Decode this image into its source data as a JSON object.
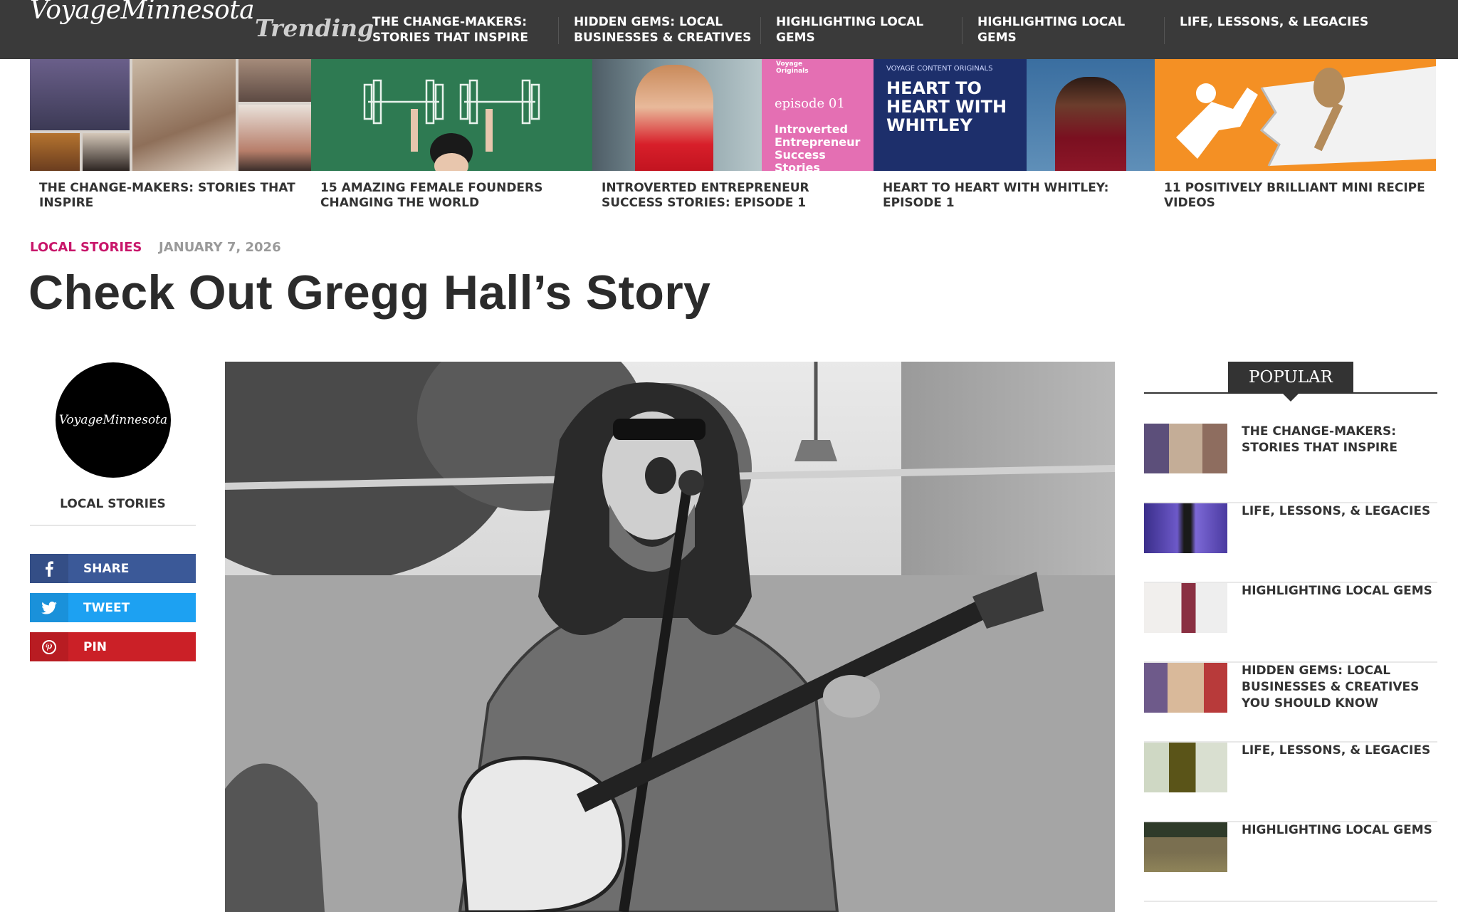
{
  "site": {
    "logo": "VoyageMinnesota"
  },
  "topbar": {
    "trending_label": "Trending",
    "nav": [
      {
        "label": "THE CHANGE-MAKERS: STORIES THAT INSPIRE"
      },
      {
        "label": "HIDDEN GEMS: LOCAL BUSINESSES & CREATIVES"
      },
      {
        "label": "HIGHLIGHTING LOCAL GEMS"
      },
      {
        "label": "HIGHLIGHTING LOCAL GEMS"
      },
      {
        "label": "LIFE, LESSONS, & LEGACIES"
      }
    ]
  },
  "trending_strip": [
    {
      "title": "THE CHANGE-MAKERS: STORIES THAT INSPIRE"
    },
    {
      "title": "15 AMAZING FEMALE FOUNDERS CHANGING THE WORLD"
    },
    {
      "title": "INTROVERTED ENTREPRENEUR SUCCESS STORIES: EPISODE 1",
      "overlay_small": "Voyage Originals",
      "overlay_episode": "episode 01",
      "overlay_text": "Introverted Entrepreneur Success Stories"
    },
    {
      "title": "HEART TO HEART WITH WHITLEY: EPISODE 1",
      "overlay_small": "VOYAGE CONTENT ORIGINALS",
      "overlay_text": "HEART TO HEART WITH WHITLEY"
    },
    {
      "title": "11 POSITIVELY BRILLIANT MINI RECIPE VIDEOS"
    }
  ],
  "article": {
    "category": "LOCAL STORIES",
    "date": "JANUARY 7, 2026",
    "headline": "Check Out Gregg Hall’s Story"
  },
  "author": {
    "avatar_text": "VoyageMinnesota",
    "category": "LOCAL STORIES"
  },
  "share": {
    "facebook": "SHARE",
    "twitter": "TWEET",
    "pinterest": "PIN"
  },
  "colors": {
    "topbar": "#3a3a3a",
    "accent": "#c8166a",
    "facebook": "#3b5998",
    "twitter": "#1da1f2",
    "pinterest": "#cb2027"
  },
  "popular": {
    "heading": "POPULAR",
    "items": [
      {
        "title": "THE CHANGE-MAKERS: STORIES THAT INSPIRE"
      },
      {
        "title": "LIFE, LESSONS, & LEGACIES"
      },
      {
        "title": "HIGHLIGHTING LOCAL GEMS"
      },
      {
        "title": "HIDDEN GEMS: LOCAL BUSINESSES & CREATIVES YOU SHOULD KNOW"
      },
      {
        "title": "LIFE, LESSONS, & LEGACIES"
      },
      {
        "title": "HIGHLIGHTING LOCAL GEMS"
      }
    ]
  }
}
